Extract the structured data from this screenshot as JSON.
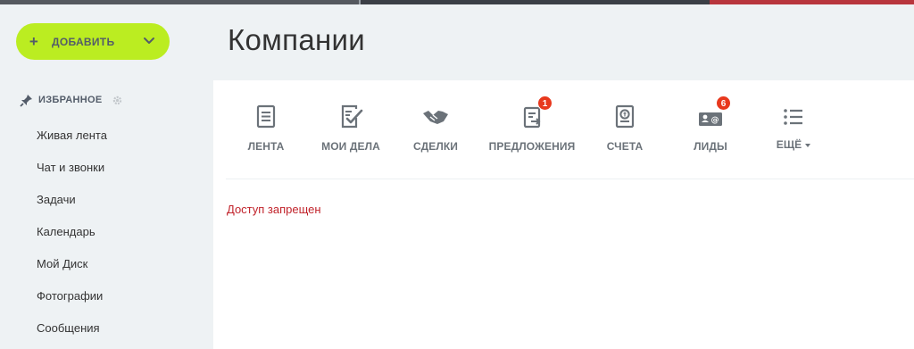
{
  "add_button": {
    "label": "ДОБАВИТЬ",
    "plus": "+"
  },
  "page_title": "Компании",
  "favorites": {
    "label": "ИЗБРАННОЕ"
  },
  "sidebar": {
    "items": [
      {
        "label": "Живая лента"
      },
      {
        "label": "Чат и звонки"
      },
      {
        "label": "Задачи"
      },
      {
        "label": "Календарь"
      },
      {
        "label": "Мой Диск"
      },
      {
        "label": "Фотографии"
      },
      {
        "label": "Сообщения"
      }
    ]
  },
  "tabs": [
    {
      "label": "ЛЕНТА",
      "icon": "feed-icon"
    },
    {
      "label": "МОИ ДЕЛА",
      "icon": "checklist-icon"
    },
    {
      "label": "СДЕЛКИ",
      "icon": "handshake-icon"
    },
    {
      "label": "ПРЕДЛОЖЕНИЯ",
      "icon": "quote-icon",
      "badge": "1"
    },
    {
      "label": "СЧЕТА",
      "icon": "invoice-icon"
    },
    {
      "label": "ЛИДЫ",
      "icon": "leads-icon",
      "badge": "6"
    },
    {
      "label": "ЕЩЁ",
      "icon": "more-list-icon"
    }
  ],
  "message": "Доступ запрещен",
  "colors": {
    "accent": "#bbed21",
    "error": "#c1232b",
    "badge": "#e8381d"
  }
}
